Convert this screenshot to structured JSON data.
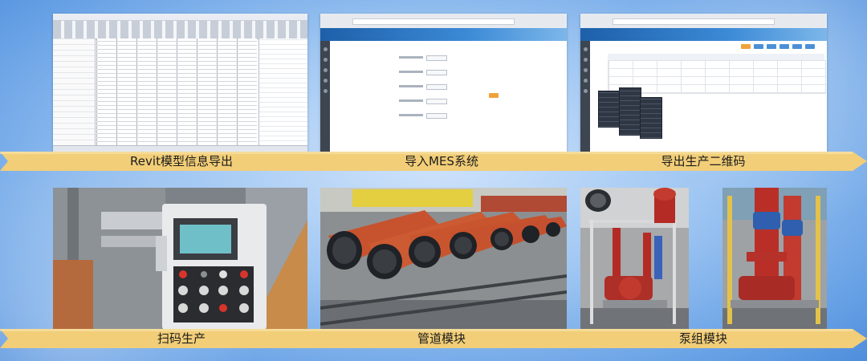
{
  "top_labels": [
    "Revit模型信息导出",
    "导入MES系统",
    "导出生产二维码"
  ],
  "bottom_labels": [
    "扫码生产",
    "管道模块",
    "泵组模块"
  ],
  "colors": {
    "arrow": "#f2ce78",
    "pipe": "#c7532e",
    "background": "#8bb9ee"
  }
}
